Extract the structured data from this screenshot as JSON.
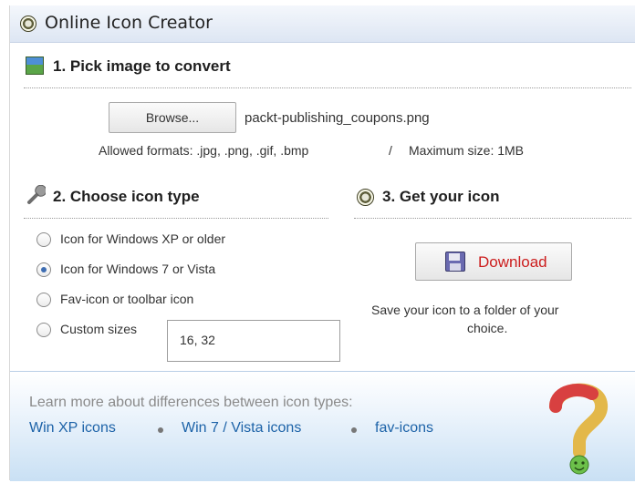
{
  "window": {
    "title": "Online Icon Creator"
  },
  "pick_section": {
    "title": "1. Pick image to convert",
    "browse_label": "Browse...",
    "filename": "packt-publishing_coupons.png",
    "formats_text": "Allowed formats: .jpg, .png, .gif, .bmp",
    "separator": "/",
    "max_size_text": "Maximum size: 1MB"
  },
  "type_section": {
    "title": "2. Choose icon type",
    "options": [
      {
        "label": "Icon for Windows XP or older",
        "selected": false
      },
      {
        "label": "Icon for Windows 7 or Vista",
        "selected": true
      },
      {
        "label": "Fav-icon or toolbar icon",
        "selected": false
      },
      {
        "label": "Custom sizes",
        "selected": false
      }
    ],
    "custom_sizes_value": "16, 32"
  },
  "get_section": {
    "title": "3. Get your icon",
    "download_label": "Download",
    "save_text_line1": "Save your icon to a folder of your",
    "save_text_line2": "choice."
  },
  "footer": {
    "learn_text": "Learn more about differences between icon types:",
    "links": [
      "Win XP icons",
      "Win 7 / Vista icons",
      "fav-icons"
    ]
  },
  "colors": {
    "link": "#1d63a8",
    "download_text": "#cc1d1d",
    "radio_selected": "#3e6db2"
  }
}
